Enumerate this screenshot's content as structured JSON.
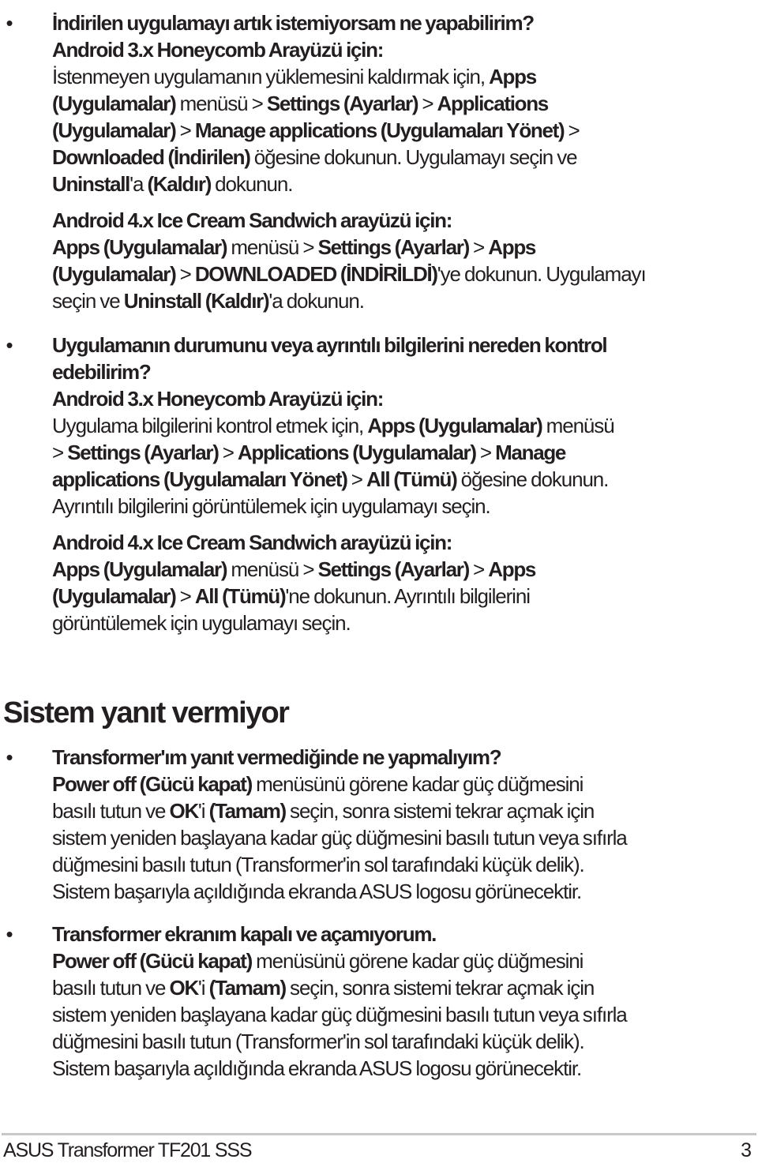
{
  "faq1": {
    "question": "İndirilen uygulamayı artık istemiyorsam ne yapabilirim?",
    "honeycomb_heading": "Android 3.x Honeycomb Arayüzü için:",
    "honeycomb_lines": [
      [
        {
          "t": "İstenmeyen uygulamanın yüklemesini kaldırmak için, ",
          "b": false
        },
        {
          "t": "Apps",
          "b": true
        }
      ],
      [
        {
          "t": "(Uygulamalar)",
          "b": true
        },
        {
          "t": " menüsü > ",
          "b": false
        },
        {
          "t": "Settings (Ayarlar)",
          "b": true
        },
        {
          "t": " > ",
          "b": false
        },
        {
          "t": "Applications",
          "b": true
        }
      ],
      [
        {
          "t": "(Uygulamalar)",
          "b": true
        },
        {
          "t": " > ",
          "b": false
        },
        {
          "t": "Manage applications (Uygulamaları Yönet)",
          "b": true
        },
        {
          "t": " >",
          "b": false
        }
      ],
      [
        {
          "t": "Downloaded (İndirilen)",
          "b": true
        },
        {
          "t": " öğesine dokunun. Uygulamayı seçin ve",
          "b": false
        }
      ],
      [
        {
          "t": "Uninstall",
          "b": true
        },
        {
          "t": "'a ",
          "b": false
        },
        {
          "t": "(Kaldır)",
          "b": true
        },
        {
          "t": " dokunun.",
          "b": false
        }
      ]
    ],
    "ics_heading": "Android 4.x Ice Cream Sandwich arayüzü için:",
    "ics_lines": [
      [
        {
          "t": "Apps (Uygulamalar)",
          "b": true
        },
        {
          "t": " menüsü > ",
          "b": false
        },
        {
          "t": "Settings (Ayarlar)",
          "b": true
        },
        {
          "t": " > ",
          "b": false
        },
        {
          "t": "Apps",
          "b": true
        }
      ],
      [
        {
          "t": "(Uygulamalar)",
          "b": true
        },
        {
          "t": " > ",
          "b": false
        },
        {
          "t": "DOWNLOADED (İNDİRİLDİ)",
          "b": true
        },
        {
          "t": "'ye dokunun. Uygulamayı",
          "b": false
        }
      ],
      [
        {
          "t": "seçin ve ",
          "b": false
        },
        {
          "t": "Uninstall (Kaldır)",
          "b": true
        },
        {
          "t": "'a dokunun.",
          "b": false
        }
      ]
    ]
  },
  "faq2": {
    "question_lines": [
      "Uygulamanın durumunu veya ayrıntılı bilgilerini nereden kontrol",
      "edebilirim?"
    ],
    "honeycomb_heading": "Android 3.x Honeycomb Arayüzü için:",
    "honeycomb_lines": [
      [
        {
          "t": "Uygulama bilgilerini kontrol etmek için, ",
          "b": false
        },
        {
          "t": "Apps (Uygulamalar)",
          "b": true
        },
        {
          "t": " menüsü",
          "b": false
        }
      ],
      [
        {
          "t": "> ",
          "b": false
        },
        {
          "t": "Settings (Ayarlar)",
          "b": true
        },
        {
          "t": " > ",
          "b": false
        },
        {
          "t": "Applications (Uygulamalar)",
          "b": true
        },
        {
          "t": " > ",
          "b": false
        },
        {
          "t": "Manage",
          "b": true
        }
      ],
      [
        {
          "t": "applications (Uygulamaları Yönet)",
          "b": true
        },
        {
          "t": " > ",
          "b": false
        },
        {
          "t": "All (Tümü)",
          "b": true
        },
        {
          "t": " öğesine dokunun.",
          "b": false
        }
      ],
      [
        {
          "t": "Ayrıntılı bilgilerini görüntülemek için uygulamayı seçin.",
          "b": false
        }
      ]
    ],
    "ics_heading": "Android 4.x Ice Cream Sandwich arayüzü için:",
    "ics_lines": [
      [
        {
          "t": "Apps (Uygulamalar)",
          "b": true
        },
        {
          "t": " menüsü > ",
          "b": false
        },
        {
          "t": "Settings (Ayarlar)",
          "b": true
        },
        {
          "t": " > ",
          "b": false
        },
        {
          "t": "Apps",
          "b": true
        }
      ],
      [
        {
          "t": "(Uygulamalar)",
          "b": true
        },
        {
          "t": " > ",
          "b": false
        },
        {
          "t": "All (Tümü)",
          "b": true
        },
        {
          "t": "'ne dokunun. Ayrıntılı bilgilerini",
          "b": false
        }
      ],
      [
        {
          "t": "görüntülemek için uygulamayı seçin.",
          "b": false
        }
      ]
    ]
  },
  "section": {
    "title": "Sistem yanıt vermiyor"
  },
  "faq3": {
    "question": "Transformer'ım yanıt vermediğinde ne yapmalıyım?",
    "lines": [
      [
        {
          "t": "Power off (Gücü kapat)",
          "b": true
        },
        {
          "t": " menüsünü görene kadar güç düğmesini",
          "b": false
        }
      ],
      [
        {
          "t": "basılı tutun ve ",
          "b": false
        },
        {
          "t": "OK",
          "b": true
        },
        {
          "t": "'i ",
          "b": false
        },
        {
          "t": "(Tamam)",
          "b": true
        },
        {
          "t": " seçin, sonra sistemi tekrar açmak için",
          "b": false
        }
      ],
      [
        {
          "t": "sistem yeniden başlayana kadar güç düğmesini basılı tutun veya sıfırla",
          "b": false
        }
      ],
      [
        {
          "t": "düğmesini basılı tutun (Transformer'in sol tarafındaki küçük delik).",
          "b": false
        }
      ],
      [
        {
          "t": "Sistem başarıyla açıldığında ekranda ASUS logosu görünecektir.",
          "b": false
        }
      ]
    ]
  },
  "faq4": {
    "question": "Transformer ekranım kapalı ve açamıyorum.",
    "lines": [
      [
        {
          "t": "Power off (Gücü kapat)",
          "b": true
        },
        {
          "t": " menüsünü görene kadar güç düğmesini",
          "b": false
        }
      ],
      [
        {
          "t": "basılı tutun ve ",
          "b": false
        },
        {
          "t": "OK",
          "b": true
        },
        {
          "t": "'i ",
          "b": false
        },
        {
          "t": "(Tamam)",
          "b": true
        },
        {
          "t": " seçin, sonra sistemi tekrar açmak için",
          "b": false
        }
      ],
      [
        {
          "t": "sistem yeniden başlayana kadar güç düğmesini basılı tutun veya sıfırla",
          "b": false
        }
      ],
      [
        {
          "t": "düğmesini basılı tutun (Transformer'in sol tarafındaki küçük delik).",
          "b": false
        }
      ],
      [
        {
          "t": "Sistem başarıyla açıldığında ekranda ASUS logosu görünecektir.",
          "b": false
        }
      ]
    ]
  },
  "bullet_glyph": "•",
  "footer": {
    "title": "ASUS Transformer TF201 SSS",
    "page_number": "3"
  }
}
